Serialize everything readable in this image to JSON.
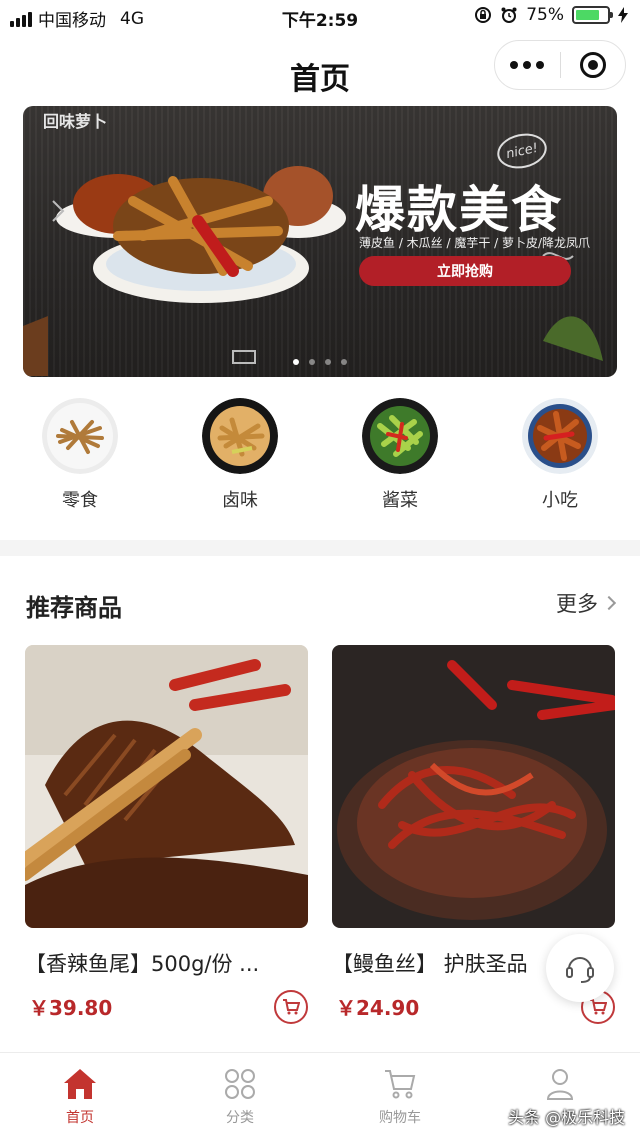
{
  "status_bar": {
    "carrier": "中国移动",
    "network": "4G",
    "time": "下午2:59",
    "battery": "75%",
    "battery_level": 0.75
  },
  "nav": {
    "title": "首页"
  },
  "banner": {
    "brand": "回味萝卜",
    "title": "爆款美食",
    "subtitle": "薄皮鱼 / 木瓜丝 / 魔芋干 / 萝卜皮/降龙凤爪",
    "button": "立即抢购",
    "bubble": "nice!",
    "slide_count": 4,
    "active_slide": 0
  },
  "categories": [
    {
      "label": "零食",
      "icon": "snack-dish-image"
    },
    {
      "label": "卤味",
      "icon": "braised-dish-image"
    },
    {
      "label": "酱菜",
      "icon": "pickle-dish-image"
    },
    {
      "label": "小吃",
      "icon": "street-food-dish-image"
    }
  ],
  "section": {
    "title": "推荐商品",
    "more": "更多"
  },
  "products": [
    {
      "name": "【香辣鱼尾】500g/份 ...",
      "price": "￥39.80",
      "image": "spicy-fish-tail-photo"
    },
    {
      "name": "【鳗鱼丝】 护肤圣品",
      "price": "￥24.90",
      "image": "eel-shreds-photo"
    }
  ],
  "tabs": [
    {
      "label": "首页",
      "icon": "home-icon",
      "active": true
    },
    {
      "label": "分类",
      "icon": "category-grid-icon",
      "active": false
    },
    {
      "label": "购物车",
      "icon": "shopping-cart-icon",
      "active": false
    },
    {
      "label": "",
      "icon": "user-icon",
      "active": false
    }
  ],
  "watermark": "头条 @极乐科技",
  "colors": {
    "accent": "#b8282a",
    "tab_active": "#c3342f",
    "battery": "#4cd964",
    "banner_button": "#b21f27"
  }
}
